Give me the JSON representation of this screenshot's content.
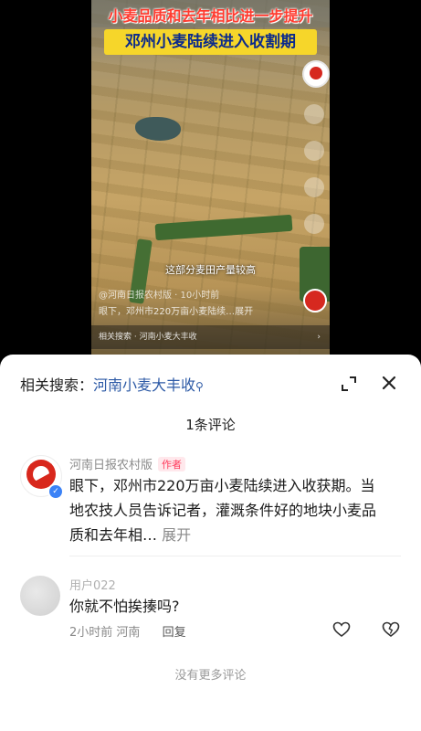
{
  "video": {
    "headline": "小麦品质和去年相比进一步提升",
    "banner": "邓州小麦陆续进入收割期",
    "subtitle": "这部分麦田产量较高",
    "author_line": "@河南日报农村版 · 10小时前",
    "desc_line": "眼下，邓州市220万亩小麦陆续…展开",
    "related_bar": "相关搜索 · 河南小麦大丰收",
    "related_chevron": "›"
  },
  "sheet": {
    "related_label": "相关搜索：",
    "related_keyword": "河南小麦大丰收",
    "related_icon": "search-icon",
    "comment_count": "1条评论",
    "no_more": "没有更多评论"
  },
  "comments": [
    {
      "name": "河南日报农村版",
      "badge": "作者",
      "text": "眼下，邓州市220万亩小麦陆续进入收获期。当地农技人员告诉记者，灌溉条件好的地块小麦品质和去年相…",
      "more": "展开"
    },
    {
      "name": "用户022",
      "text": "你就不怕挨揍吗?",
      "time": "2小时前",
      "location": "河南",
      "reply": "回复"
    }
  ],
  "colors": {
    "headline_red": "#ff3b2f",
    "banner_yellow": "#f6d62a",
    "link_blue": "#2d5aa6",
    "badge_pink": "#ff3b5c"
  }
}
